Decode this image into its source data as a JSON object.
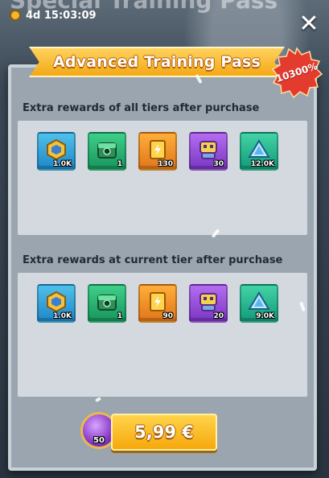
{
  "header": {
    "bg_title": "Special Training Pass",
    "timer": "4d 15:03:09"
  },
  "dialog": {
    "title": "Advanced Training Pass",
    "badge": "10300%"
  },
  "sections": [
    {
      "title": "Extra rewards of all tiers after purchase",
      "items": [
        {
          "icon": "hexagon-token-icon",
          "qty": "1.0K",
          "color": "#2a97d6"
        },
        {
          "icon": "green-chest-icon",
          "qty": "1",
          "color": "#23b070"
        },
        {
          "icon": "gold-card-icon",
          "qty": "130",
          "color": "#f08c25"
        },
        {
          "icon": "purple-robot-icon",
          "qty": "30",
          "color": "#9a4fdc"
        },
        {
          "icon": "crystal-icon",
          "qty": "12.0K",
          "color": "#20b58a"
        }
      ]
    },
    {
      "title": "Extra rewards at current tier after purchase",
      "items": [
        {
          "icon": "hexagon-token-icon",
          "qty": "1.0K",
          "color": "#2a97d6"
        },
        {
          "icon": "green-chest-icon",
          "qty": "1",
          "color": "#23b070"
        },
        {
          "icon": "gold-card-icon",
          "qty": "90",
          "color": "#f08c25"
        },
        {
          "icon": "purple-robot-icon",
          "qty": "20",
          "color": "#9a4fdc"
        },
        {
          "icon": "crystal-icon",
          "qty": "9.0K",
          "color": "#20b58a"
        }
      ]
    }
  ],
  "purchase": {
    "gem_amount": "50",
    "price": "5,99 €"
  }
}
